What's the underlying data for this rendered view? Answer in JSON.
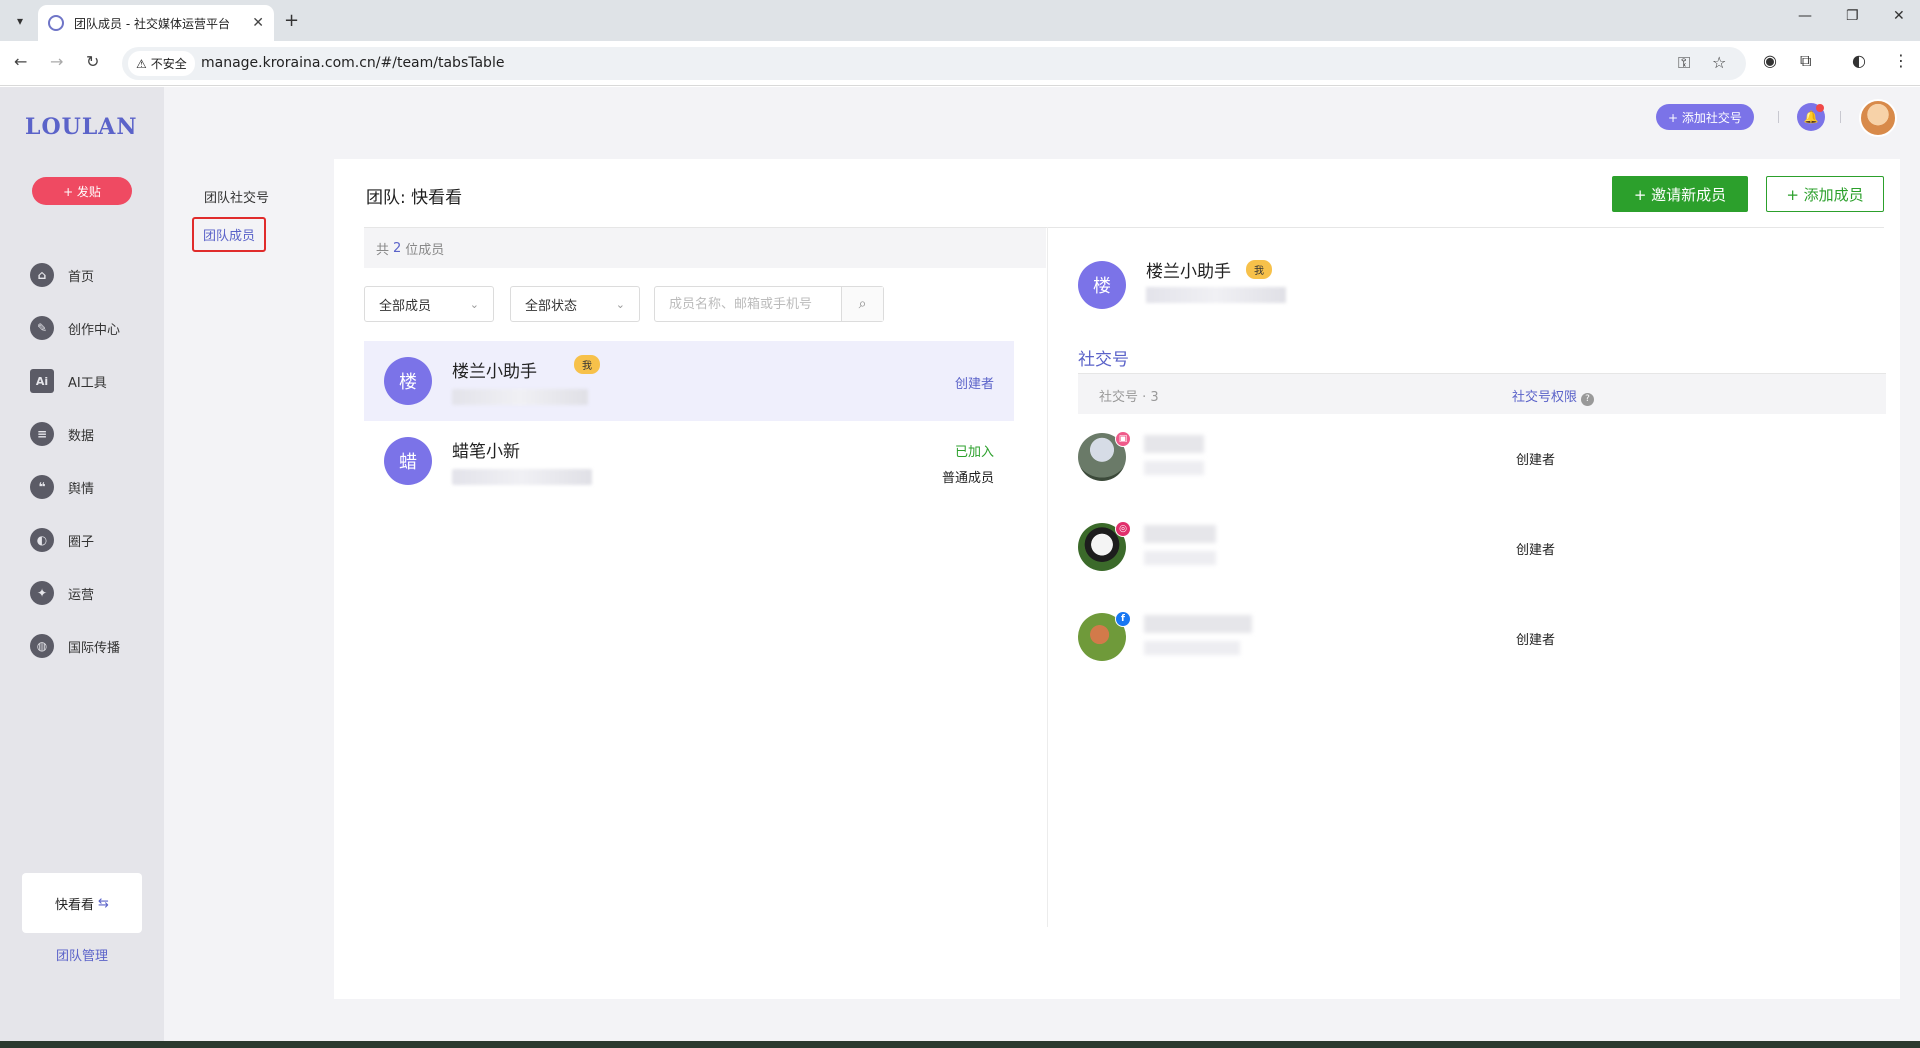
{
  "browser": {
    "tab_title": "团队成员 - 社交媒体运营平台",
    "tab_close": "✕",
    "new_tab": "+",
    "security_label": "不安全",
    "url": "manage.kroraina.com.cn/#/team/tabsTable",
    "window_controls": [
      "—",
      "❐",
      "✕"
    ]
  },
  "app": {
    "logo": "LOULAN",
    "post_button": "+ 发贴",
    "nav": [
      {
        "label": "首页",
        "icon": "home-icon",
        "glyph": "⌂"
      },
      {
        "label": "创作中心",
        "icon": "palette-icon",
        "glyph": "✎"
      },
      {
        "label": "AI工具",
        "icon": "ai-icon",
        "glyph": "Ai"
      },
      {
        "label": "数据",
        "icon": "database-icon",
        "glyph": "≡"
      },
      {
        "label": "舆情",
        "icon": "quote-icon",
        "glyph": "❝"
      },
      {
        "label": "圈子",
        "icon": "compass-icon",
        "glyph": "◐"
      },
      {
        "label": "运营",
        "icon": "operations-icon",
        "glyph": "✦"
      },
      {
        "label": "国际传播",
        "icon": "globe-icon",
        "glyph": "◍"
      }
    ],
    "team_card": "快看看",
    "team_switch_glyph": "⇆",
    "team_manage": "团队管理"
  },
  "topbar": {
    "add_social": "+ 添加社交号",
    "bell_glyph": "🔔"
  },
  "subnav": {
    "items": [
      "团队社交号",
      "团队成员"
    ],
    "active": "团队成员"
  },
  "main": {
    "title": "团队: 快看看",
    "invite_button": "+ 邀请新成员",
    "add_member_button": "+ 添加成员",
    "count_prefix": "共",
    "count_value": "2",
    "count_suffix": "位成员",
    "filter_members": "全部成员",
    "filter_status": "全部状态",
    "search_placeholder": "成员名称、邮箱或手机号",
    "members": [
      {
        "avatar": "楼",
        "name": "楼兰小助手",
        "badge": "我",
        "status": "创建者",
        "status_color": "#5b63c9",
        "role": ""
      },
      {
        "avatar": "蜡",
        "name": "蜡笔小新",
        "badge": "",
        "status": "已加入",
        "status_color": "#2ca02c",
        "role": "普通成员"
      }
    ]
  },
  "detail": {
    "avatar": "楼",
    "name": "楼兰小助手",
    "badge": "我",
    "tab": "社交号",
    "col_account": "社交号 · 3",
    "col_permission": "社交号权限",
    "help_glyph": "?",
    "accounts": [
      {
        "platform": "tiktok-icon",
        "platform_glyph": "▣",
        "platform_color": "#ef5a8a",
        "permission": "创建者"
      },
      {
        "platform": "instagram-icon",
        "platform_glyph": "◎",
        "platform_color": "#e1306c",
        "permission": "创建者"
      },
      {
        "platform": "facebook-icon",
        "platform_glyph": "f",
        "platform_color": "#1877f2",
        "permission": "创建者"
      }
    ]
  }
}
